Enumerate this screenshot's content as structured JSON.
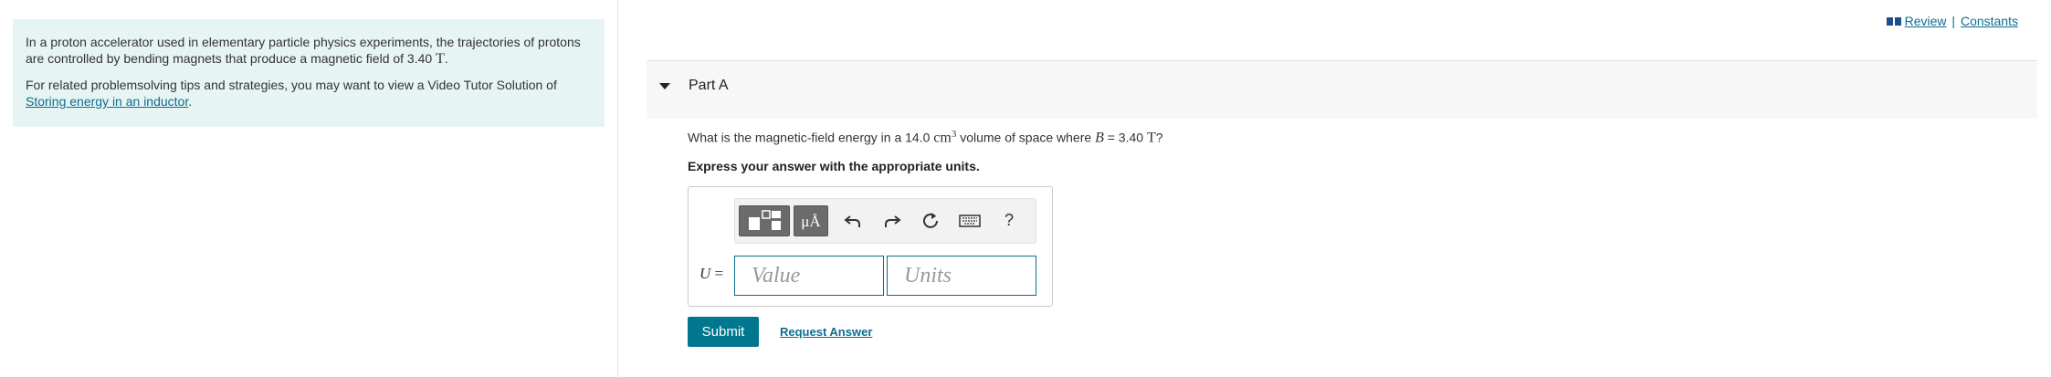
{
  "problem": {
    "text1": "In a proton accelerator used in elementary particle physics experiments, the trajectories of protons are controlled by bending magnets that produce a magnetic field of 3.40 ",
    "field_unit": "T",
    "text1_end": ".",
    "text2": "For related problemsolving tips and strategies, you may want to view a Video Tutor Solution of ",
    "link": "Storing energy in an inductor",
    "text2_end": "."
  },
  "top_links": {
    "review": "Review",
    "separator": "|",
    "constants": "Constants"
  },
  "part": {
    "title": "Part A"
  },
  "question": {
    "pre": "What is the magnetic-field energy in a 14.0 ",
    "unit": "cm",
    "unit_exp": "3",
    "mid": " volume of space where ",
    "var": "B",
    "eq": " = 3.40 ",
    "b_unit": "T",
    "end": "?"
  },
  "instruction": "Express your answer with the appropriate units.",
  "answer": {
    "label_var": "U",
    "label_eq": " =",
    "value_placeholder": "Value",
    "units_placeholder": "Units"
  },
  "toolbar": {
    "units_button": "μÅ",
    "help": "?"
  },
  "buttons": {
    "submit": "Submit",
    "request": "Request Answer"
  }
}
